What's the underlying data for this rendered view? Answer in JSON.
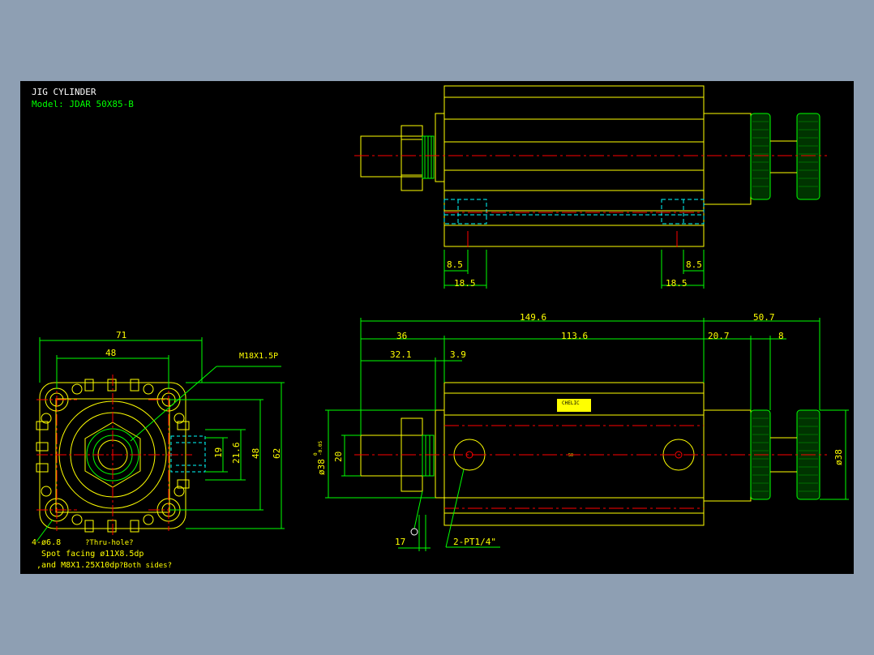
{
  "title": "JIG CYLINDER",
  "model": "Model: JDAR 50X85-B",
  "colors": {
    "background": "#8e9fb3",
    "canvas": "#000000",
    "outline": "#ffff00",
    "dimension": "#00ff00",
    "centerline": "#ff0000",
    "hidden": "#00ffff",
    "white_text": "#ffffff"
  },
  "top_view": {
    "dims": {
      "left_inner": "8.5",
      "left_outer": "18.5",
      "right_inner": "8.5",
      "right_outer": "18.5"
    }
  },
  "front_view": {
    "dims": {
      "width_71": "71",
      "width_48": "48",
      "height_19": "19",
      "height_21_6": "21.6",
      "height_48": "48",
      "height_62": "62",
      "thread": "M18X1.5P"
    },
    "notes": {
      "line1_size": "4-ø6.8",
      "line1_note": "?Thru-hole?",
      "line2": "Spot facing  ø11X8.5dp",
      "line3_size": ",and M8X1.25X10dp",
      "line3_note": "?Both sides?"
    }
  },
  "side_view": {
    "dims": {
      "overall": "149.6",
      "right_overall": "50.7",
      "rod": "36",
      "body": "113.6",
      "knob_a": "20.7",
      "knob_b": "8",
      "rod_len": "32.1",
      "flange": "3.9",
      "rod_dia": "20",
      "bore_dia": "ø38",
      "bore_tol_upper": "0",
      "bore_tol_lower": "-0.05",
      "knob_dia": "ø38",
      "wrench": "17",
      "ports": "2-PT1/4\""
    },
    "label": "CHELIC",
    "center_mark": "50"
  }
}
